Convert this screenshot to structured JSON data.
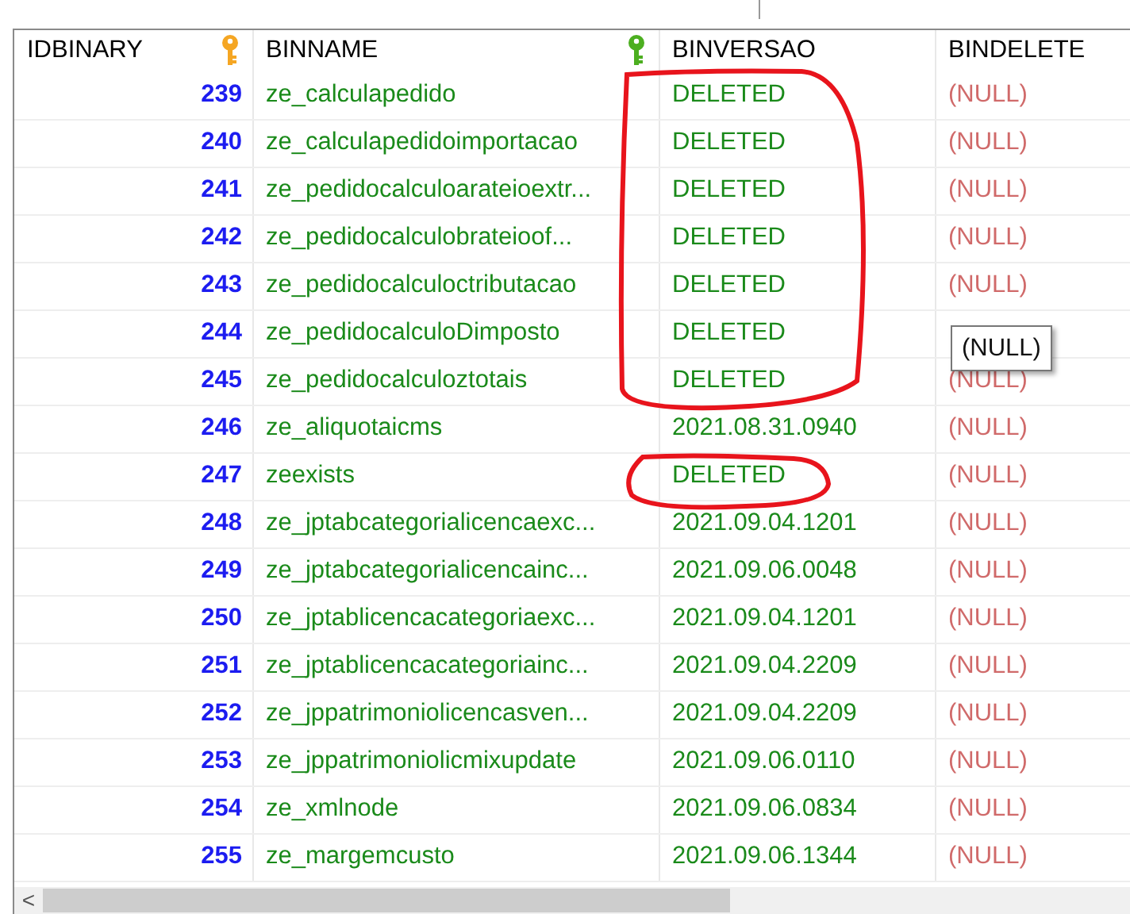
{
  "columns": [
    {
      "label": "IDBINARY",
      "color": "#f5a623"
    },
    {
      "label": "BINNAME",
      "color": "#4caf20"
    },
    {
      "label": "BINVERSAO"
    },
    {
      "label": "BINDELETE"
    }
  ],
  "rows": [
    {
      "id": "239",
      "name": "ze_calculapedido",
      "version": "DELETED",
      "delete": "(NULL)"
    },
    {
      "id": "240",
      "name": "ze_calculapedidoimportacao",
      "version": "DELETED",
      "delete": "(NULL)"
    },
    {
      "id": "241",
      "name": "ze_pedidocalculoarateioextr...",
      "version": "DELETED",
      "delete": "(NULL)"
    },
    {
      "id": "242",
      "name": "ze_pedidocalculobrateioof...",
      "version": "DELETED",
      "delete": "(NULL)"
    },
    {
      "id": "243",
      "name": "ze_pedidocalculoctributacao",
      "version": "DELETED",
      "delete": "(NULL)"
    },
    {
      "id": "244",
      "name": "ze_pedidocalculoDimposto",
      "version": "DELETED"
    },
    {
      "id": "245",
      "name": "ze_pedidocalculoztotais",
      "version": "DELETED",
      "delete": "(NULL)"
    },
    {
      "id": "246",
      "name": "ze_aliquotaicms",
      "version": "2021.08.31.0940",
      "delete": "(NULL)"
    },
    {
      "id": "247",
      "name": "zeexists",
      "version": "DELETED",
      "delete": "(NULL)"
    },
    {
      "id": "248",
      "name": "ze_jptabcategorialicencaexc...",
      "version": "2021.09.04.1201",
      "delete": "(NULL)"
    },
    {
      "id": "249",
      "name": "ze_jptabcategorialicencainc...",
      "version": "2021.09.06.0048",
      "delete": "(NULL)"
    },
    {
      "id": "250",
      "name": "ze_jptablicencacategoriaexc...",
      "version": "2021.09.04.1201",
      "delete": "(NULL)"
    },
    {
      "id": "251",
      "name": "ze_jptablicencacategoriainc...",
      "version": "2021.09.04.2209",
      "delete": "(NULL)"
    },
    {
      "id": "252",
      "name": "ze_jppatrimoniolicencasven...",
      "version": "2021.09.04.2209",
      "delete": "(NULL)"
    },
    {
      "id": "253",
      "name": "ze_jppatrimoniolicmixupdate",
      "version": "2021.09.06.0110",
      "delete": "(NULL)"
    },
    {
      "id": "254",
      "name": "ze_xmlnode",
      "version": "2021.09.06.0834",
      "delete": "(NULL)"
    },
    {
      "id": "255",
      "name": "ze_margemcusto",
      "version": "2021.09.06.1344",
      "delete": "(NULL)"
    }
  ],
  "tooltip": "(NULL)",
  "scrollbar": {
    "left_arrow": "<"
  }
}
